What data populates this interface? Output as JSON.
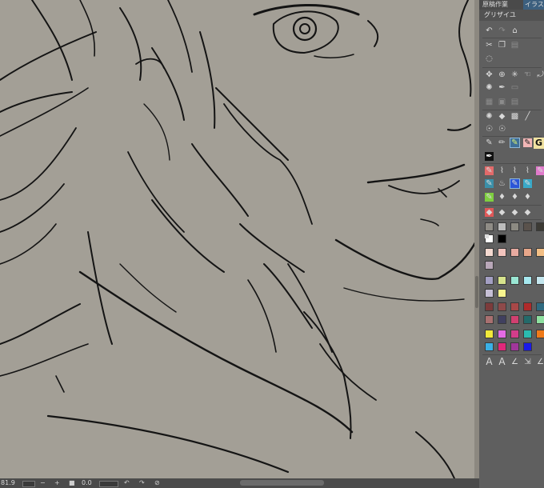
{
  "panel": {
    "tabs": [
      "原稿作業",
      "イラスト"
    ],
    "subtab": "グリザイユ",
    "text_tools": [
      "A",
      "A"
    ]
  },
  "status": {
    "zoom": "81.9",
    "angle": "0.0",
    "minus": "−",
    "plus": "+"
  },
  "icons": [
    "undo-icon",
    "redo-icon",
    "trash-icon",
    "cut-icon",
    "copy-icon",
    "paste-icon",
    "lasso-icon",
    "move-icon",
    "zoom-icon",
    "auto-select-icon",
    "hand-icon",
    "rotate-icon",
    "loading-icon",
    "eyedropper-icon",
    "blank-icon",
    "ruler-icon",
    "frame-icon",
    "stamp-icon",
    "brush-mark-icon",
    "fill-icon",
    "gradient-icon",
    "line-icon",
    "blend-icon",
    "blend2-icon",
    "pen-icon",
    "pencil-icon",
    "marker-icon",
    "highlight-pen-icon"
  ],
  "swatch_colors": {
    "row_gray": [
      "#8f8c86",
      "#bcbcbc",
      "#8c8a82",
      "#5a524c",
      "#3c3a34"
    ],
    "row_bw": [
      "#ffffff",
      "#000000"
    ],
    "row_pastel": [
      "#f4d9d0",
      "#f2c4bd",
      "#e7aaa0",
      "#e8a78a",
      "#f3bf85",
      "#b8a7b8"
    ],
    "row_cool": [
      "#a39fc3",
      "#d7e38c",
      "#9ae6d3",
      "#a6e8ef",
      "#c4e6ee",
      "#c6c0d6",
      "#f8f48e"
    ],
    "row_dark": [
      "#7c3b3b",
      "#8e4a4a",
      "#a84848",
      "#b02a2a",
      "#2f6a80",
      "#a87070",
      "#40405f",
      "#d04070",
      "#246a6a"
    ],
    "row_bright": [
      "#f1e93a",
      "#e36be4",
      "#d13d8a",
      "#2bbbb0",
      "#f07a18",
      "#3ab0e6",
      "#e0287a",
      "#a0369a",
      "#1a1ae8"
    ]
  }
}
